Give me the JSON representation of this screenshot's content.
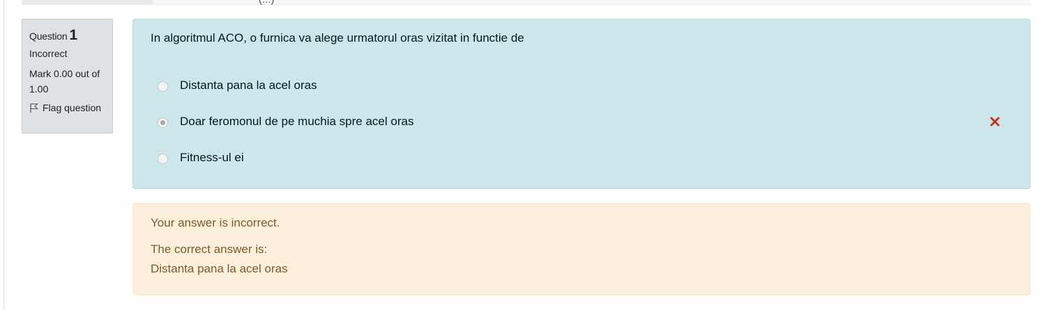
{
  "top_strip": {
    "cut_text": "(...)"
  },
  "info": {
    "question_label": "Question",
    "question_number": "1",
    "state": "Incorrect",
    "grade": "Mark 0.00 out of 1.00",
    "flag_label": "Flag question"
  },
  "question": {
    "text": "In algoritmul ACO, o furnica va alege urmatorul oras vizitat in functie de",
    "options": [
      {
        "label": "Distanta pana la acel oras",
        "selected": false,
        "mark": ""
      },
      {
        "label": "Doar feromonul de pe muchia spre acel oras",
        "selected": true,
        "mark": "incorrect"
      },
      {
        "label": "Fitness-ul ei",
        "selected": false,
        "mark": ""
      }
    ]
  },
  "feedback": {
    "general": "Your answer is incorrect.",
    "right_answer_intro": "The correct answer is:",
    "right_answer_value": "Distanta pana la acel oras"
  },
  "colors": {
    "formulation_bg": "#cce6ea",
    "outcome_bg": "#fcefdc",
    "incorrect_icon": "#ca3120",
    "info_bg": "#dee2e6"
  }
}
